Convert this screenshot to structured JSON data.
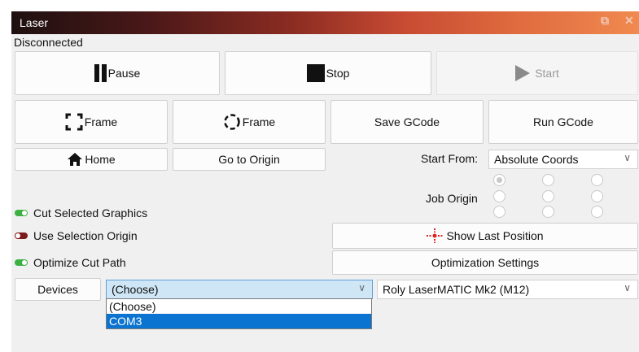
{
  "window": {
    "title": "Laser",
    "float_icon": "restore-window-icon",
    "close_icon": "close-icon"
  },
  "status": "Disconnected",
  "controls": {
    "pause": "Pause",
    "stop": "Stop",
    "start": "Start"
  },
  "actions": {
    "frame_rect": "Frame",
    "frame_circle": "Frame",
    "save_gcode": "Save GCode",
    "run_gcode": "Run GCode",
    "home": "Home",
    "go_to_origin": "Go to Origin"
  },
  "start_from": {
    "label": "Start From:",
    "value": "Absolute Coords"
  },
  "job_origin": {
    "label": "Job Origin",
    "selected": "top-left"
  },
  "options": [
    {
      "label": "Cut Selected Graphics",
      "enabled": true
    },
    {
      "label": "Use Selection Origin",
      "enabled": false
    },
    {
      "label": "Optimize Cut Path",
      "enabled": true
    }
  ],
  "show_last_position": "Show Last Position",
  "optimization_settings": "Optimization Settings",
  "devices": {
    "button": "Devices",
    "port_value": "(Choose)",
    "port_options": [
      "(Choose)",
      "COM3"
    ],
    "port_highlighted": "COM3",
    "device_value": "Roly LaserMATIC Mk2 (M12)"
  },
  "colors": {
    "accent_on": "#3cb043",
    "accent_off": "#7d1a1a",
    "selection": "#0a74d0"
  }
}
